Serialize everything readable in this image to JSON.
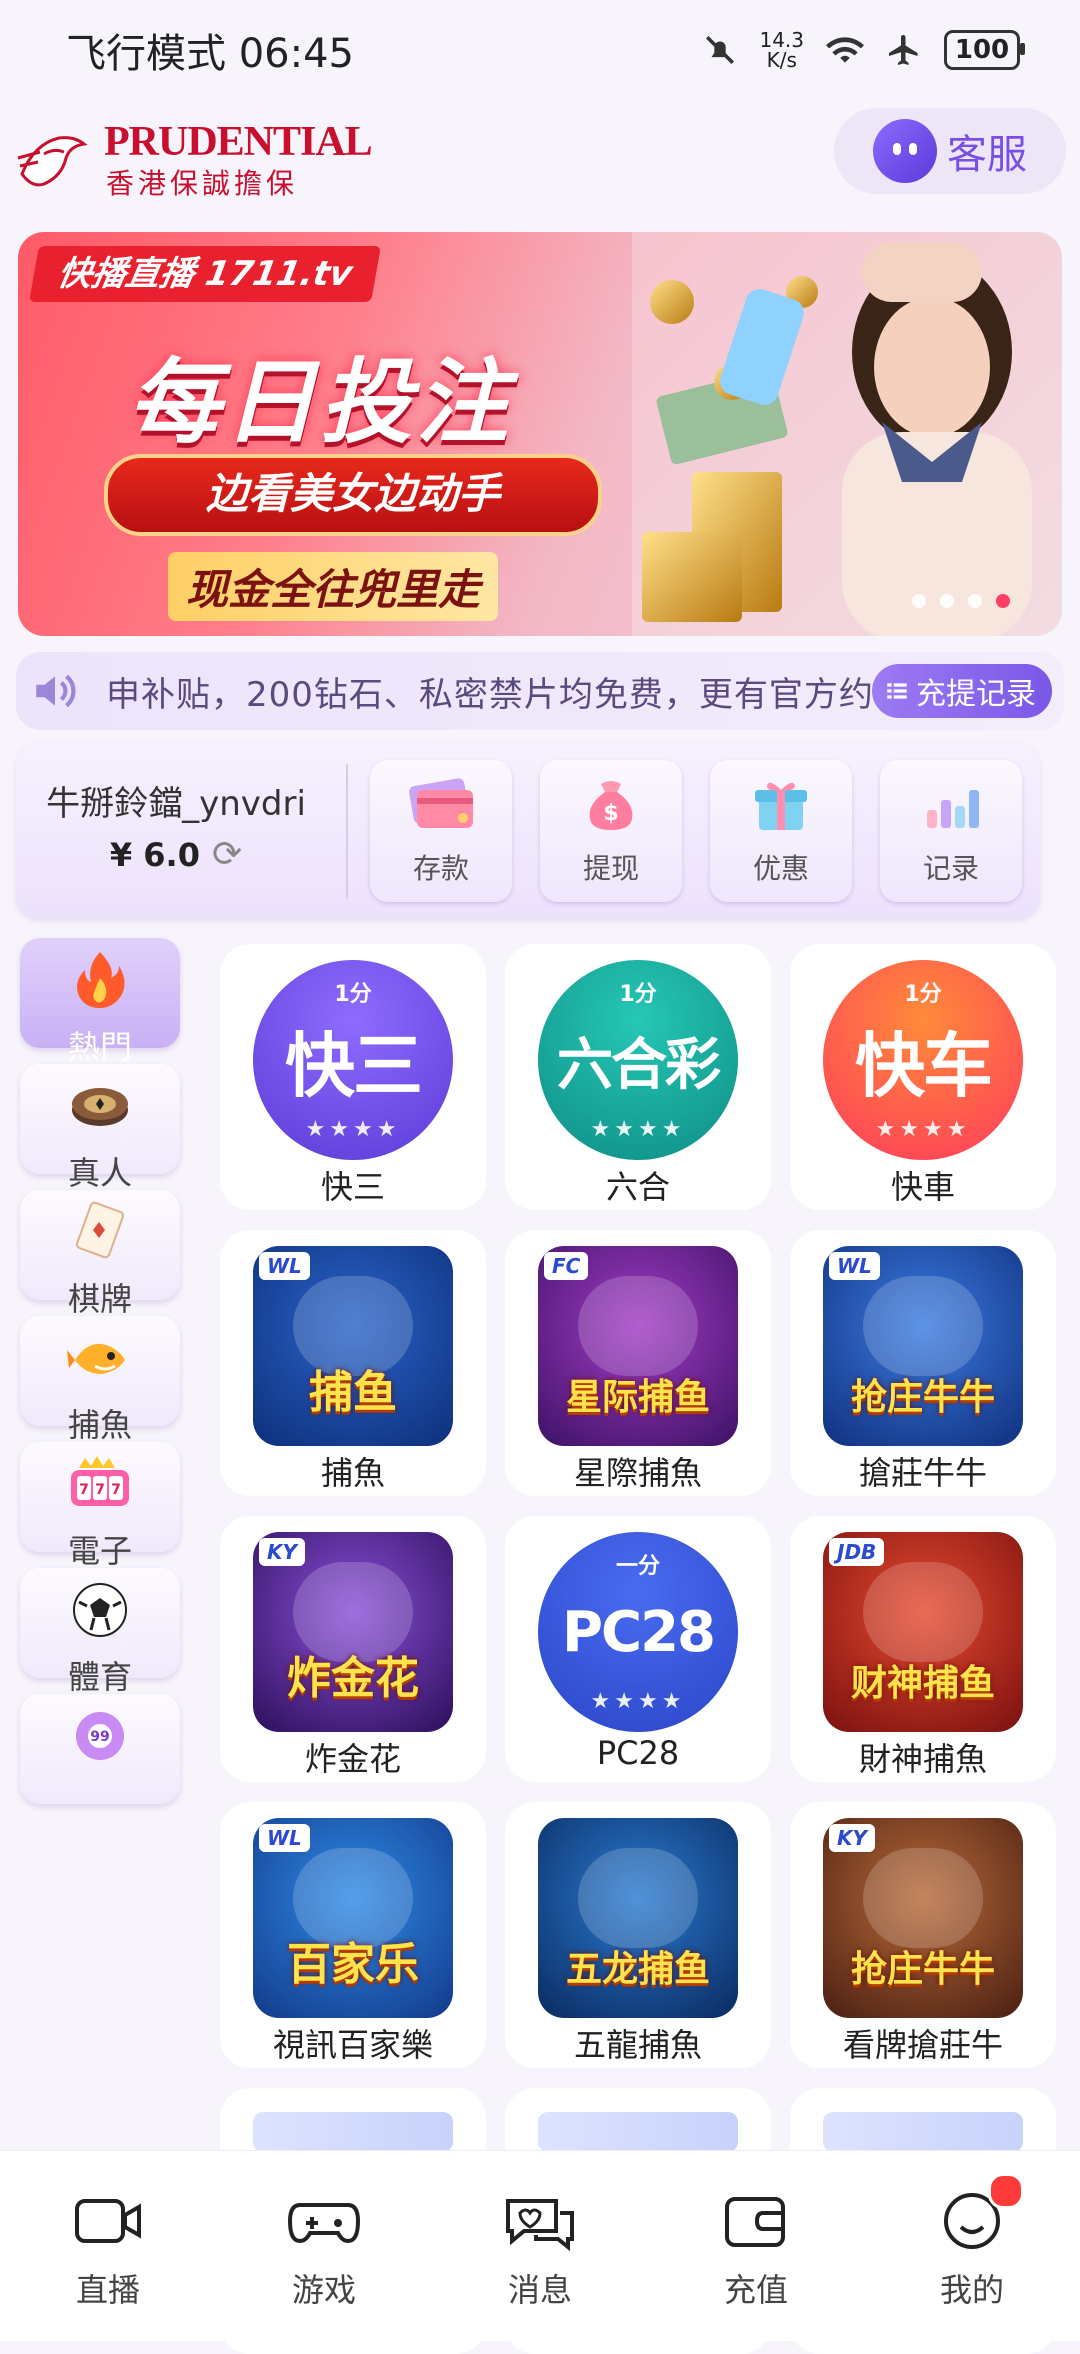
{
  "status_bar": {
    "left_text": "飞行模式 06:45",
    "net_speed_value": "14.3",
    "net_speed_unit": "K/s",
    "battery": "100"
  },
  "header": {
    "logo_title": "PRUDENTIAL",
    "logo_subtitle": "香港保誠擔保",
    "service_label": "客服"
  },
  "banner": {
    "brand": "快播直播 1711.tv",
    "headline": "每日投注",
    "pill": "边看美女边动手",
    "line": "现金全往兜里走",
    "slides": 4,
    "active_slide": 4
  },
  "marquee": {
    "text": "申补贴，200钻石、私密禁片均免费，更有官方约",
    "records_label": "充提记录"
  },
  "account": {
    "username": "牛掰鈴鐺_ynvdri",
    "balance": "¥ 6.0",
    "actions": [
      {
        "label": "存款",
        "icon": "card-icon"
      },
      {
        "label": "提现",
        "icon": "money-bag-icon"
      },
      {
        "label": "优惠",
        "icon": "gift-icon"
      },
      {
        "label": "记录",
        "icon": "bar-chart-icon"
      }
    ]
  },
  "categories": [
    {
      "label": "熱門",
      "icon": "fire-icon",
      "active": true
    },
    {
      "label": "真人",
      "icon": "chip-icon",
      "active": false
    },
    {
      "label": "棋牌",
      "icon": "cards-icon",
      "active": false
    },
    {
      "label": "捕魚",
      "icon": "fish-icon",
      "active": false
    },
    {
      "label": "電子",
      "icon": "slot-icon",
      "active": false
    },
    {
      "label": "體育",
      "icon": "soccer-ball-icon",
      "active": false
    },
    {
      "label": "",
      "icon": "lottery-ball-icon",
      "active": false
    }
  ],
  "games": [
    {
      "name": "快三",
      "art": "快三",
      "tag": "1分",
      "style": "circle",
      "color1": "#8f6cff",
      "color2": "#5a3bd6"
    },
    {
      "name": "六合",
      "art": "六合彩",
      "tag": "1分",
      "style": "circle",
      "color1": "#25c7b5",
      "color2": "#0f8d86"
    },
    {
      "name": "快車",
      "art": "快车",
      "tag": "1分",
      "style": "circle",
      "color1": "#ff8a3a",
      "color2": "#ff3b5c"
    },
    {
      "name": "捕魚",
      "art": "捕鱼",
      "tag": "WL",
      "style": "art",
      "color1": "#2a64c9",
      "color2": "#0d2f7a"
    },
    {
      "name": "星際捕魚",
      "art": "星际捕鱼",
      "tag": "FC",
      "style": "art",
      "color1": "#a23bc4",
      "color2": "#3d1266"
    },
    {
      "name": "搶莊牛牛",
      "art": "抢庄牛牛",
      "tag": "WL",
      "style": "art",
      "color1": "#3a7be0",
      "color2": "#10307e"
    },
    {
      "name": "炸金花",
      "art": "炸金花",
      "tag": "KY",
      "style": "art",
      "color1": "#8a4fd8",
      "color2": "#2c0f5a"
    },
    {
      "name": "PC28",
      "art": "PC28",
      "tag": "一分",
      "style": "circle",
      "color1": "#4a6cf0",
      "color2": "#2b45c8"
    },
    {
      "name": "財神捕魚",
      "art": "财神捕鱼",
      "tag": "JDB",
      "style": "art",
      "color1": "#e64a2e",
      "color2": "#7a1010"
    },
    {
      "name": "視訊百家樂",
      "art": "百家乐",
      "tag": "WL",
      "style": "art",
      "color1": "#2f8ae6",
      "color2": "#123a8a"
    },
    {
      "name": "五龍捕魚",
      "art": "五龙捕鱼",
      "tag": "",
      "style": "art",
      "color1": "#2a7ad0",
      "color2": "#0a2a60"
    },
    {
      "name": "看牌搶莊牛",
      "art": "抢庄牛牛",
      "tag": "KY",
      "style": "art",
      "color1": "#b86a3a",
      "color2": "#4a1f12"
    }
  ],
  "bottom_nav": [
    {
      "label": "直播",
      "icon": "camera-icon"
    },
    {
      "label": "游戏",
      "icon": "gamepad-icon"
    },
    {
      "label": "消息",
      "icon": "chat-icon"
    },
    {
      "label": "充值",
      "icon": "wallet-icon"
    },
    {
      "label": "我的",
      "icon": "profile-icon",
      "badge": true
    }
  ],
  "colors": {
    "accent": "#7a58e8",
    "background": "#f7f4fb",
    "banner_red": "#e9202d",
    "badge": "#ff3a3a"
  }
}
